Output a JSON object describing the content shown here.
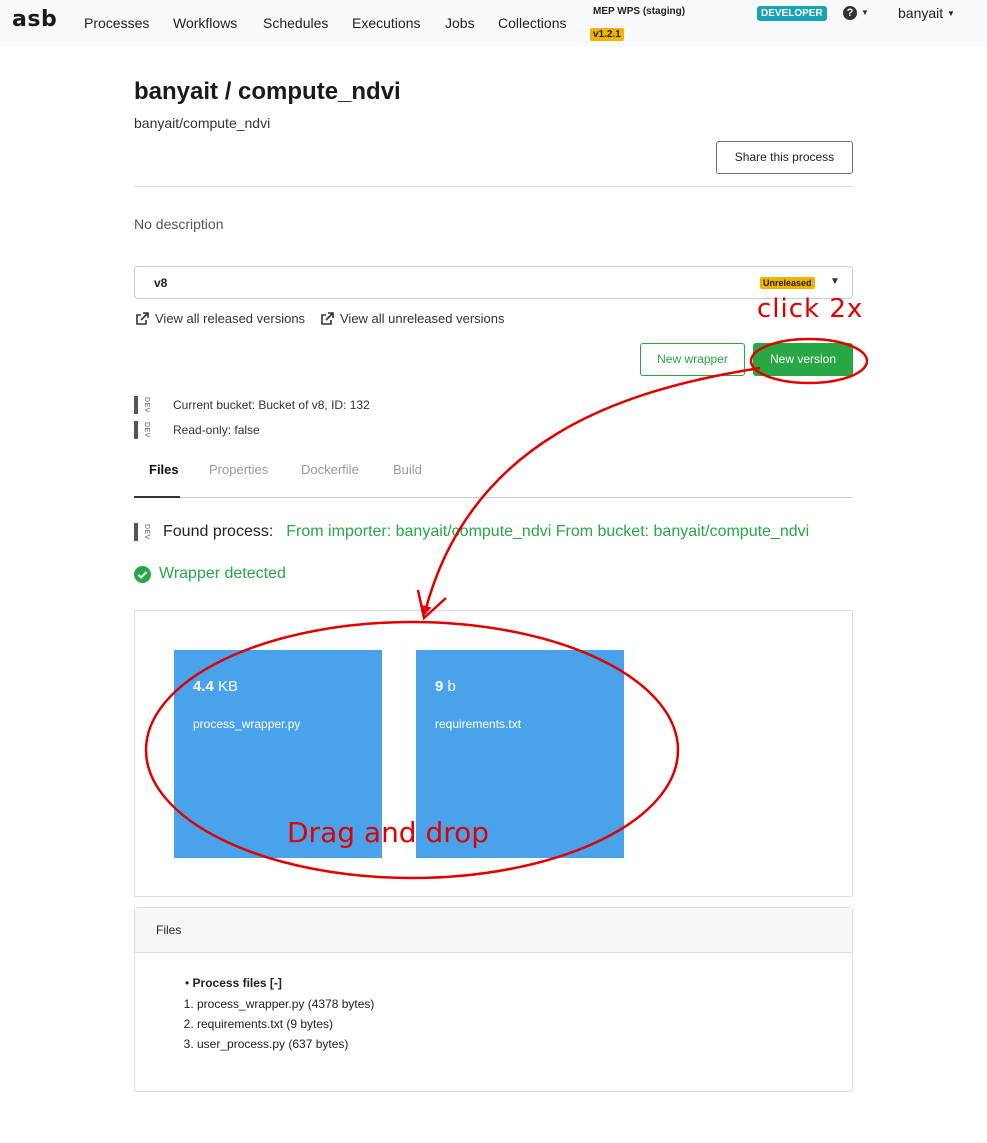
{
  "navbar": {
    "brand": "asb",
    "links": [
      "Processes",
      "Workflows",
      "Schedules",
      "Executions",
      "Jobs",
      "Collections"
    ],
    "environment": "MEP WPS (staging)",
    "version": "v1.2.1",
    "role_badge": "DEVELOPER",
    "help_icon": "question-circle-icon",
    "user": "banyait"
  },
  "process": {
    "title": "banyait / compute_ndvi",
    "subtitle": "banyait/compute_ndvi",
    "share_label": "Share this process",
    "description": "No description"
  },
  "version_select": {
    "selected": "v8",
    "badge": "Unreleased"
  },
  "links": {
    "released": "View all released versions",
    "unreleased": "View all unreleased versions"
  },
  "actions": {
    "new_wrapper": "New wrapper",
    "new_version": "New version"
  },
  "dev_info": {
    "tag": "DEV",
    "bucket": "Current bucket: Bucket of v8, ID: 132",
    "readonly": "Read-only: false"
  },
  "tabs": [
    {
      "label": "Files",
      "active": true
    },
    {
      "label": "Properties",
      "active": false
    },
    {
      "label": "Dockerfile",
      "active": false
    },
    {
      "label": "Build",
      "active": false
    }
  ],
  "found": {
    "label": "Found process:",
    "value": "From importer: banyait/compute_ndvi From bucket: banyait/compute_ndvi"
  },
  "wrapper_detected": "Wrapper detected",
  "tiles": [
    {
      "size_num": "4.4",
      "size_unit": "KB",
      "name": "process_wrapper.py"
    },
    {
      "size_num": "9",
      "size_unit": "b",
      "name": "requirements.txt"
    }
  ],
  "files_card": {
    "header": "Files",
    "group": "Process files [-]",
    "items": [
      "process_wrapper.py (4378 bytes)",
      "requirements.txt (9 bytes)",
      "user_process.py (637 bytes)"
    ]
  },
  "annotations": {
    "click_note": "click 2x",
    "drag_note": "Drag and drop",
    "color": "#e00000"
  },
  "colors": {
    "success": "#28a745",
    "tile": "#4aa3ea",
    "warning": "#f0b400",
    "info": "#17a2b8"
  }
}
